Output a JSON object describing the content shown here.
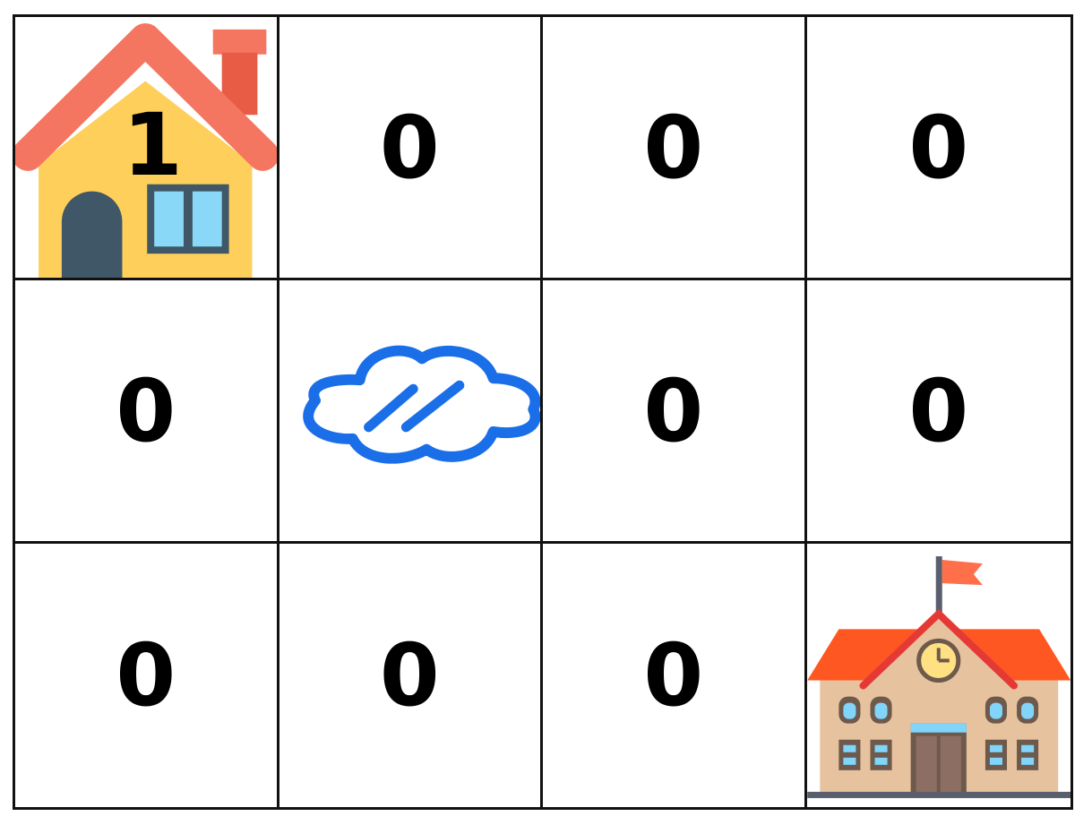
{
  "grid": {
    "rows": 3,
    "cols": 4,
    "cells": [
      [
        {
          "value": "1",
          "icon": "house-icon"
        },
        {
          "value": "0"
        },
        {
          "value": "0"
        },
        {
          "value": "0"
        }
      ],
      [
        {
          "value": "0"
        },
        {
          "value": "",
          "icon": "puddle-icon"
        },
        {
          "value": "0"
        },
        {
          "value": "0"
        }
      ],
      [
        {
          "value": "0"
        },
        {
          "value": "0"
        },
        {
          "value": "0"
        },
        {
          "value": "",
          "icon": "school-icon"
        }
      ]
    ]
  },
  "colors": {
    "roof": "#F47560",
    "house_wall": "#FECF5A",
    "door": "#3F5766",
    "window": "#8AD8F7",
    "puddle": "#1A6FE8",
    "school_roof": "#FF5722",
    "school_wall": "#E7C29E",
    "flag": "#FF6F4A"
  }
}
